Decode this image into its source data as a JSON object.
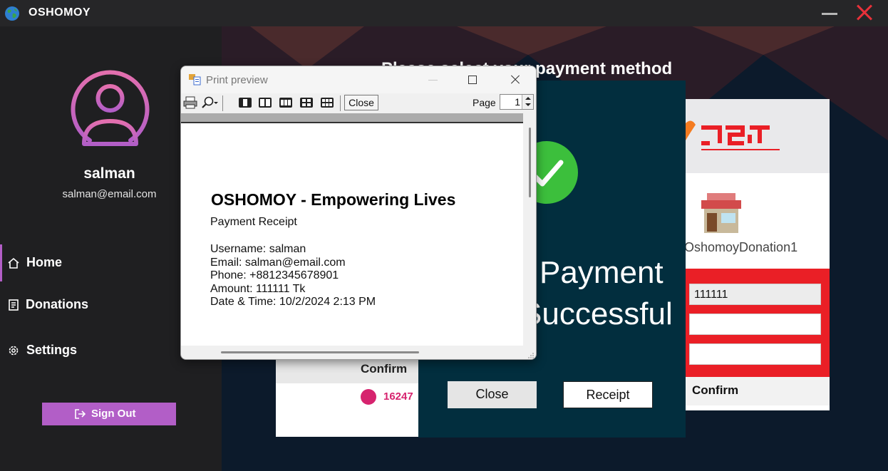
{
  "app": {
    "title": "OSHOMOY"
  },
  "sidebar": {
    "user_name": "salman",
    "user_email": "salman@email.com",
    "nav": [
      {
        "label": "Home",
        "icon": "home-icon",
        "active": true
      },
      {
        "label": "Donations",
        "icon": "document-icon",
        "active": false
      },
      {
        "label": "Settings",
        "icon": "gear-icon",
        "active": false
      }
    ],
    "signout_label": "Sign Out",
    "accent_color": "#b25ec7"
  },
  "main": {
    "heading": "Please select your payment method",
    "left_card": {
      "confirm_label": "Confirm",
      "hotline": "16247"
    },
    "nagad_card": {
      "merchant": "OshomoyDonation1",
      "fields": [
        "111111",
        "",
        ""
      ],
      "confirm_label": "Confirm",
      "brand_color": "#ea1f26"
    },
    "success_dialog": {
      "line1": "Payment",
      "line2": "Successful",
      "close_label": "Close",
      "receipt_label": "Receipt",
      "background_color": "#022e3e"
    }
  },
  "print_preview": {
    "window_title": "Print preview",
    "close_label": "Close",
    "page_label": "Page",
    "page_value": "1",
    "receipt": {
      "title": "OSHOMOY - Empowering Lives",
      "subtitle": "Payment Receipt",
      "lines": [
        "Username: salman",
        "Email: salman@email.com",
        "Phone: +8812345678901",
        "Amount: 111111 Tk",
        "Date & Time: 10/2/2024 2:13 PM"
      ]
    }
  }
}
